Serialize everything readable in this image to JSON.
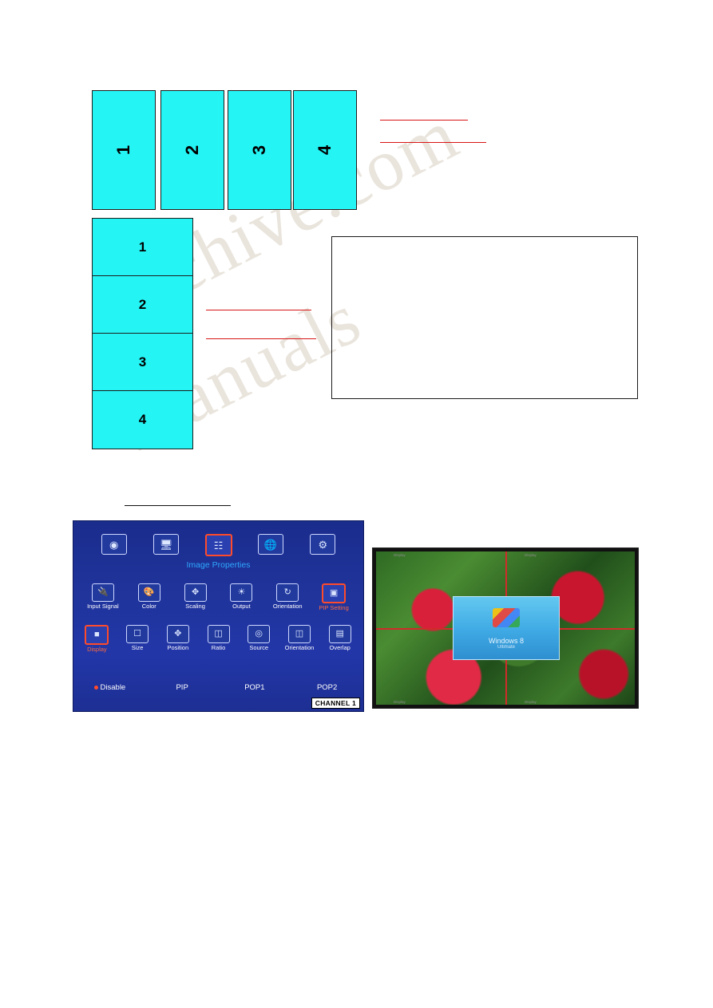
{
  "document": {
    "watermark_text": "archive.com",
    "watermark_text2": "manuals"
  },
  "top_panels": {
    "name": "vertical-split-4-panels",
    "labels": [
      "1",
      "2",
      "3",
      "4"
    ]
  },
  "column_panels": {
    "name": "horizontal-split-4-panels",
    "labels": [
      "1",
      "2",
      "3",
      "4"
    ]
  },
  "osd": {
    "title": "Image Properties",
    "channel_badge": "CHANNEL 1",
    "row1": [
      {
        "label": "",
        "icon": "color-wheel-icon"
      },
      {
        "label": "",
        "icon": "monitor-icon"
      },
      {
        "label": "Image Properties",
        "icon": "equalizer-icon",
        "selected": true
      },
      {
        "label": "",
        "icon": "globe-icon"
      },
      {
        "label": "",
        "icon": "gear-icon"
      }
    ],
    "row2": [
      {
        "label": "Input Signal",
        "icon": "hdmi-plug-icon"
      },
      {
        "label": "Color",
        "icon": "palette-icon"
      },
      {
        "label": "Scaling",
        "icon": "arrows-expand-icon"
      },
      {
        "label": "Output",
        "icon": "sun-icon"
      },
      {
        "label": "Orientation",
        "icon": "rotate-icon"
      },
      {
        "label": "PIP Setting",
        "icon": "pip-icon",
        "selected": true
      }
    ],
    "row3": [
      {
        "label": "Display",
        "icon": "display-icon",
        "selected": true
      },
      {
        "label": "Size",
        "icon": "size-icon"
      },
      {
        "label": "Position",
        "icon": "position-icon"
      },
      {
        "label": "Ratio",
        "icon": "ratio-icon"
      },
      {
        "label": "Source",
        "icon": "source-icon"
      },
      {
        "label": "Orientation",
        "icon": "orientation-icon"
      },
      {
        "label": "Overlap",
        "icon": "overlap-icon"
      }
    ],
    "modes": [
      {
        "label": "Disable",
        "selected": true
      },
      {
        "label": "PIP",
        "selected": false
      },
      {
        "label": "POP1",
        "selected": false
      },
      {
        "label": "POP2",
        "selected": false
      }
    ]
  },
  "video_wall": {
    "name": "video-wall-photo",
    "pip_title": "Windows 8",
    "pip_subtitle": "Ultimate",
    "corner_labels": [
      "Display",
      "Display",
      "Display",
      "Display"
    ]
  }
}
